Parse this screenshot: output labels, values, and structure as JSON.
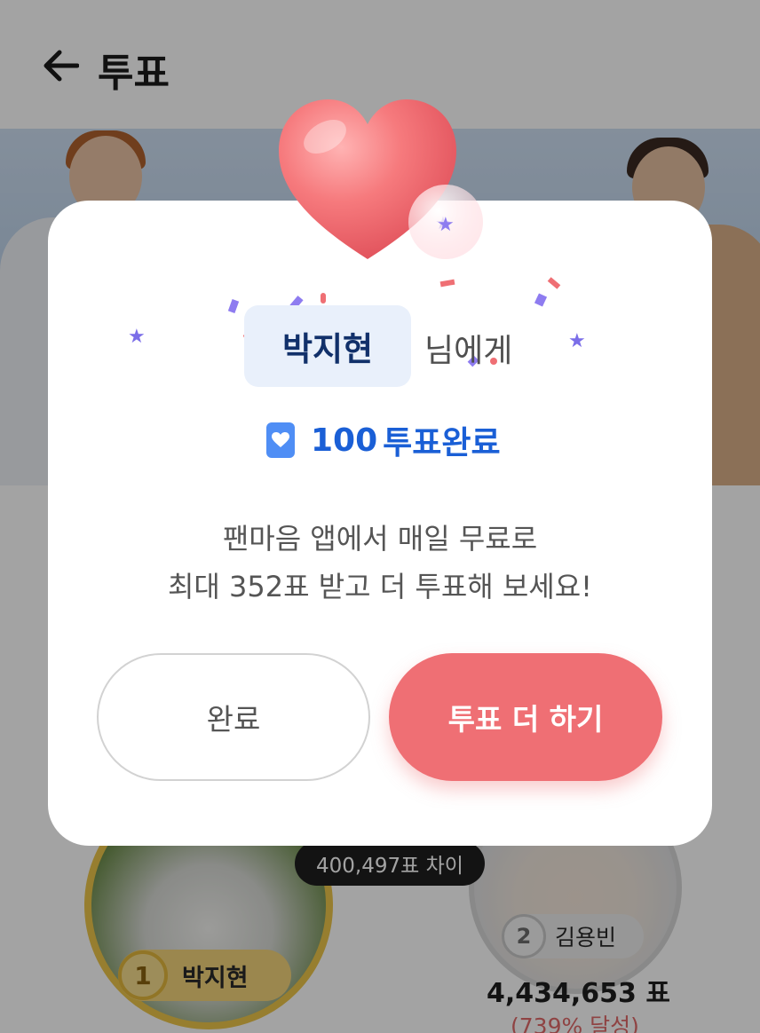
{
  "header": {
    "title": "투표"
  },
  "banner": {
    "text": ""
  },
  "ranking": {
    "difference": "400,497표 차이",
    "first": {
      "rank": "1",
      "name": "박지현"
    },
    "second": {
      "rank": "2",
      "name": "김용빈",
      "votes": "4,434,653 표",
      "percent": "(739% 달성)"
    }
  },
  "modal": {
    "recipient_name": "박지현",
    "recipient_suffix": "님에게",
    "vote_count": "100",
    "vote_done": "투표완료",
    "description_line1": "팬마음 앱에서 매일 무료로",
    "description_line2": "최대 352표 받고 더 투표해 보세요!",
    "done_button": "완료",
    "more_button": "투표 더 하기"
  },
  "colors": {
    "accent_red": "#ef6f74",
    "accent_blue": "#1a5fd6",
    "gold": "#ecc54a"
  }
}
